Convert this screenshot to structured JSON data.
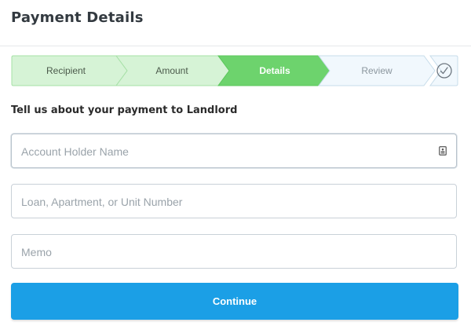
{
  "header": {
    "title": "Payment Details"
  },
  "stepper": {
    "steps": [
      {
        "label": "Recipient",
        "state": "done"
      },
      {
        "label": "Amount",
        "state": "done"
      },
      {
        "label": "Details",
        "state": "active"
      },
      {
        "label": "Review",
        "state": "upcoming"
      }
    ],
    "final_icon": "checkmark-circle-icon",
    "colors": {
      "done_fill": "#d6f3d6",
      "done_stroke": "#a7e0a7",
      "done_text": "#4b5a4b",
      "active_fill": "#6dd36d",
      "active_text": "#ffffff",
      "upcoming_fill": "#f1f8fd",
      "upcoming_stroke": "#c7dcea",
      "upcoming_text": "#8b969e"
    }
  },
  "form": {
    "subtitle": "Tell us about your payment to Landlord",
    "fields": [
      {
        "placeholder": "Account Holder Name",
        "value": "",
        "icon": "contact-card-icon"
      },
      {
        "placeholder": "Loan, Apartment, or Unit Number",
        "value": ""
      },
      {
        "placeholder": "Memo",
        "value": ""
      }
    ],
    "submit_label": "Continue",
    "submit_color": "#1b9fe6"
  }
}
